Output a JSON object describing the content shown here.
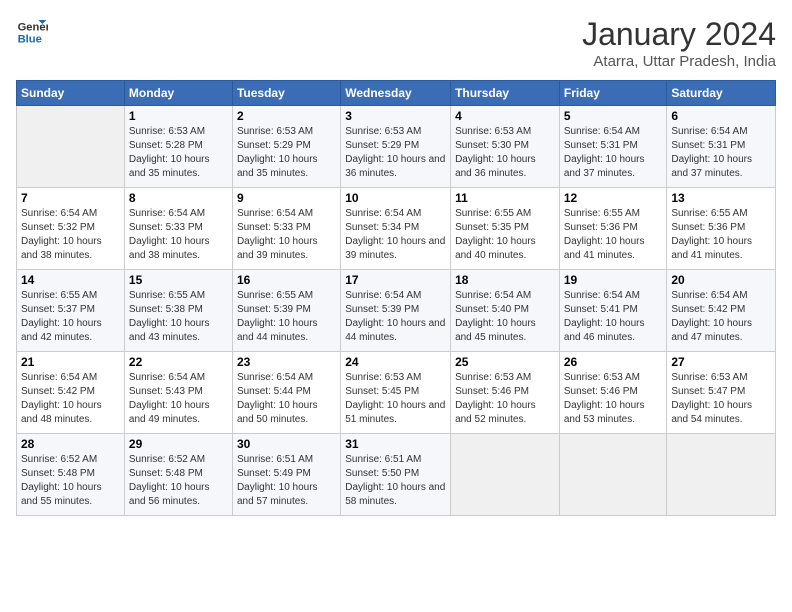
{
  "header": {
    "logo_line1": "General",
    "logo_line2": "Blue",
    "month": "January 2024",
    "location": "Atarra, Uttar Pradesh, India"
  },
  "weekdays": [
    "Sunday",
    "Monday",
    "Tuesday",
    "Wednesday",
    "Thursday",
    "Friday",
    "Saturday"
  ],
  "weeks": [
    [
      {
        "day": "",
        "sunrise": "",
        "sunset": "",
        "daylight": ""
      },
      {
        "day": "1",
        "sunrise": "Sunrise: 6:53 AM",
        "sunset": "Sunset: 5:28 PM",
        "daylight": "Daylight: 10 hours and 35 minutes."
      },
      {
        "day": "2",
        "sunrise": "Sunrise: 6:53 AM",
        "sunset": "Sunset: 5:29 PM",
        "daylight": "Daylight: 10 hours and 35 minutes."
      },
      {
        "day": "3",
        "sunrise": "Sunrise: 6:53 AM",
        "sunset": "Sunset: 5:29 PM",
        "daylight": "Daylight: 10 hours and 36 minutes."
      },
      {
        "day": "4",
        "sunrise": "Sunrise: 6:53 AM",
        "sunset": "Sunset: 5:30 PM",
        "daylight": "Daylight: 10 hours and 36 minutes."
      },
      {
        "day": "5",
        "sunrise": "Sunrise: 6:54 AM",
        "sunset": "Sunset: 5:31 PM",
        "daylight": "Daylight: 10 hours and 37 minutes."
      },
      {
        "day": "6",
        "sunrise": "Sunrise: 6:54 AM",
        "sunset": "Sunset: 5:31 PM",
        "daylight": "Daylight: 10 hours and 37 minutes."
      }
    ],
    [
      {
        "day": "7",
        "sunrise": "Sunrise: 6:54 AM",
        "sunset": "Sunset: 5:32 PM",
        "daylight": "Daylight: 10 hours and 38 minutes."
      },
      {
        "day": "8",
        "sunrise": "Sunrise: 6:54 AM",
        "sunset": "Sunset: 5:33 PM",
        "daylight": "Daylight: 10 hours and 38 minutes."
      },
      {
        "day": "9",
        "sunrise": "Sunrise: 6:54 AM",
        "sunset": "Sunset: 5:33 PM",
        "daylight": "Daylight: 10 hours and 39 minutes."
      },
      {
        "day": "10",
        "sunrise": "Sunrise: 6:54 AM",
        "sunset": "Sunset: 5:34 PM",
        "daylight": "Daylight: 10 hours and 39 minutes."
      },
      {
        "day": "11",
        "sunrise": "Sunrise: 6:55 AM",
        "sunset": "Sunset: 5:35 PM",
        "daylight": "Daylight: 10 hours and 40 minutes."
      },
      {
        "day": "12",
        "sunrise": "Sunrise: 6:55 AM",
        "sunset": "Sunset: 5:36 PM",
        "daylight": "Daylight: 10 hours and 41 minutes."
      },
      {
        "day": "13",
        "sunrise": "Sunrise: 6:55 AM",
        "sunset": "Sunset: 5:36 PM",
        "daylight": "Daylight: 10 hours and 41 minutes."
      }
    ],
    [
      {
        "day": "14",
        "sunrise": "Sunrise: 6:55 AM",
        "sunset": "Sunset: 5:37 PM",
        "daylight": "Daylight: 10 hours and 42 minutes."
      },
      {
        "day": "15",
        "sunrise": "Sunrise: 6:55 AM",
        "sunset": "Sunset: 5:38 PM",
        "daylight": "Daylight: 10 hours and 43 minutes."
      },
      {
        "day": "16",
        "sunrise": "Sunrise: 6:55 AM",
        "sunset": "Sunset: 5:39 PM",
        "daylight": "Daylight: 10 hours and 44 minutes."
      },
      {
        "day": "17",
        "sunrise": "Sunrise: 6:54 AM",
        "sunset": "Sunset: 5:39 PM",
        "daylight": "Daylight: 10 hours and 44 minutes."
      },
      {
        "day": "18",
        "sunrise": "Sunrise: 6:54 AM",
        "sunset": "Sunset: 5:40 PM",
        "daylight": "Daylight: 10 hours and 45 minutes."
      },
      {
        "day": "19",
        "sunrise": "Sunrise: 6:54 AM",
        "sunset": "Sunset: 5:41 PM",
        "daylight": "Daylight: 10 hours and 46 minutes."
      },
      {
        "day": "20",
        "sunrise": "Sunrise: 6:54 AM",
        "sunset": "Sunset: 5:42 PM",
        "daylight": "Daylight: 10 hours and 47 minutes."
      }
    ],
    [
      {
        "day": "21",
        "sunrise": "Sunrise: 6:54 AM",
        "sunset": "Sunset: 5:42 PM",
        "daylight": "Daylight: 10 hours and 48 minutes."
      },
      {
        "day": "22",
        "sunrise": "Sunrise: 6:54 AM",
        "sunset": "Sunset: 5:43 PM",
        "daylight": "Daylight: 10 hours and 49 minutes."
      },
      {
        "day": "23",
        "sunrise": "Sunrise: 6:54 AM",
        "sunset": "Sunset: 5:44 PM",
        "daylight": "Daylight: 10 hours and 50 minutes."
      },
      {
        "day": "24",
        "sunrise": "Sunrise: 6:53 AM",
        "sunset": "Sunset: 5:45 PM",
        "daylight": "Daylight: 10 hours and 51 minutes."
      },
      {
        "day": "25",
        "sunrise": "Sunrise: 6:53 AM",
        "sunset": "Sunset: 5:46 PM",
        "daylight": "Daylight: 10 hours and 52 minutes."
      },
      {
        "day": "26",
        "sunrise": "Sunrise: 6:53 AM",
        "sunset": "Sunset: 5:46 PM",
        "daylight": "Daylight: 10 hours and 53 minutes."
      },
      {
        "day": "27",
        "sunrise": "Sunrise: 6:53 AM",
        "sunset": "Sunset: 5:47 PM",
        "daylight": "Daylight: 10 hours and 54 minutes."
      }
    ],
    [
      {
        "day": "28",
        "sunrise": "Sunrise: 6:52 AM",
        "sunset": "Sunset: 5:48 PM",
        "daylight": "Daylight: 10 hours and 55 minutes."
      },
      {
        "day": "29",
        "sunrise": "Sunrise: 6:52 AM",
        "sunset": "Sunset: 5:48 PM",
        "daylight": "Daylight: 10 hours and 56 minutes."
      },
      {
        "day": "30",
        "sunrise": "Sunrise: 6:51 AM",
        "sunset": "Sunset: 5:49 PM",
        "daylight": "Daylight: 10 hours and 57 minutes."
      },
      {
        "day": "31",
        "sunrise": "Sunrise: 6:51 AM",
        "sunset": "Sunset: 5:50 PM",
        "daylight": "Daylight: 10 hours and 58 minutes."
      },
      {
        "day": "",
        "sunrise": "",
        "sunset": "",
        "daylight": ""
      },
      {
        "day": "",
        "sunrise": "",
        "sunset": "",
        "daylight": ""
      },
      {
        "day": "",
        "sunrise": "",
        "sunset": "",
        "daylight": ""
      }
    ]
  ]
}
